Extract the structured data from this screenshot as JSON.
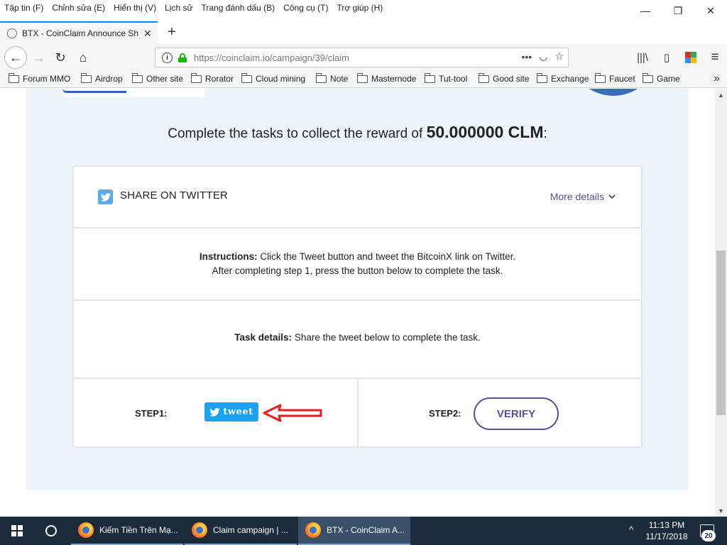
{
  "menu": {
    "items": [
      "Tập tin (F)",
      "Chỉnh sửa (E)",
      "Hiển thị (V)",
      "Lịch sử",
      "Trang đánh dấu (B)",
      "Công cụ (T)",
      "Trợ giúp (H)"
    ]
  },
  "window_controls": {
    "minimize": "—",
    "restore": "❐",
    "close": "✕"
  },
  "tab": {
    "title": "BTX - CoinClaim Announce Sh",
    "close": "✕",
    "new_tab": "+"
  },
  "nav": {
    "back": "←",
    "forward": "→",
    "reload": "↻",
    "home": "⌂",
    "url": "https://coinclaim.io/campaign/39/claim",
    "info": "i",
    "page_actions": "•••",
    "pocket": "◡",
    "star": "☆",
    "library": "|||\\",
    "sidebar": "▯",
    "menu": "≡"
  },
  "bookmarks": {
    "items": [
      "Forum MMO",
      "Airdrop",
      "Other site",
      "Rorator",
      "Cloud mining",
      "Note",
      "Masternode",
      "Tut-tool",
      "Good site",
      "Exchange",
      "Faucet",
      "Game"
    ],
    "overflow": "»"
  },
  "page": {
    "heading_prefix": "Complete the tasks to collect the reward of ",
    "reward_amount": "50.000000 CLM",
    "heading_suffix": ":",
    "share_title": "SHARE ON TWITTER",
    "more_details": "More details",
    "instructions_label": "Instructions:",
    "instructions_text": " Click the Tweet button and tweet the BitcoinX link on Twitter.",
    "instructions_line2": "After completing step 1, press the button below to complete the task.",
    "task_details_label": "Task details:",
    "task_details_text": " Share the tweet below to complete the task.",
    "step1_label": "STEP1:",
    "tweet_label": "tweet",
    "step2_label": "STEP2:",
    "verify_label": "VERIFY"
  },
  "colors": {
    "accent_purple": "#5b4e9e",
    "twitter_blue": "#1da1f2",
    "arrow_red": "#e02020",
    "page_background": "#eef4fc"
  },
  "taskbar": {
    "apps": [
      {
        "title": "Kiếm Tiền Trên Mạ..."
      },
      {
        "title": "Claim campaign | ..."
      },
      {
        "title": "BTX - CoinClaim A..."
      }
    ],
    "tray_chevron": "^",
    "time": "11:13 PM",
    "date": "11/17/2018",
    "notifications": "20"
  },
  "scrollbar": {
    "up": "▲",
    "down": "▼"
  }
}
